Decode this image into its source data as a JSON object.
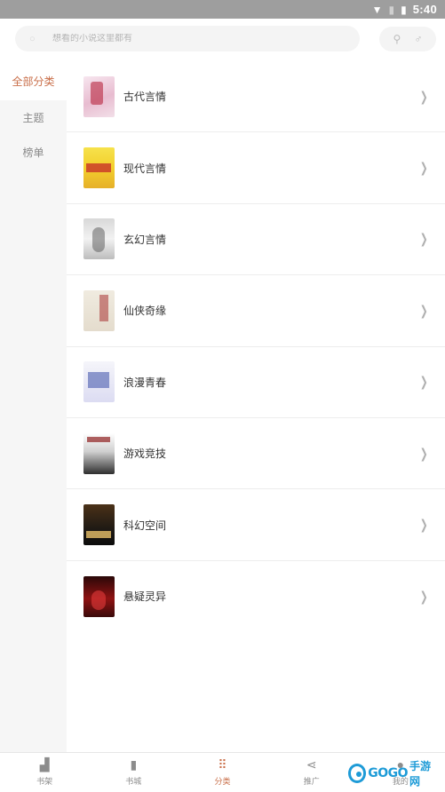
{
  "status": {
    "time": "5:40",
    "icons": [
      "wifi-icon",
      "sim-icon",
      "battery-icon"
    ]
  },
  "search": {
    "placeholder": "想看的小说这里都有",
    "icon": "search-icon"
  },
  "header_actions": {
    "icons": [
      "search-small-icon",
      "gender-male-icon"
    ]
  },
  "sidebar": {
    "items": [
      {
        "label": "全部分类",
        "active": true
      },
      {
        "label": "主题",
        "active": false
      },
      {
        "label": "榜单",
        "active": false
      }
    ]
  },
  "categories": [
    {
      "label": "古代言情"
    },
    {
      "label": "现代言情"
    },
    {
      "label": "玄幻言情"
    },
    {
      "label": "仙侠奇缘"
    },
    {
      "label": "浪漫青春"
    },
    {
      "label": "游戏竞技"
    },
    {
      "label": "科幻空间"
    },
    {
      "label": "悬疑灵异"
    }
  ],
  "tabbar": {
    "items": [
      {
        "label": "书架",
        "icon": "bookshelf-icon",
        "active": false
      },
      {
        "label": "书城",
        "icon": "book-icon",
        "active": false
      },
      {
        "label": "分类",
        "icon": "category-icon",
        "active": true
      },
      {
        "label": "推广",
        "icon": "share-icon",
        "active": false
      },
      {
        "label": "我的",
        "icon": "user-icon",
        "active": false
      }
    ]
  },
  "watermark": {
    "text": "GOGO",
    "suffix": "手游网"
  },
  "colors": {
    "accent": "#c96f4a",
    "statusbar": "#9e9e9e",
    "watermark": "#1e9bd7"
  }
}
